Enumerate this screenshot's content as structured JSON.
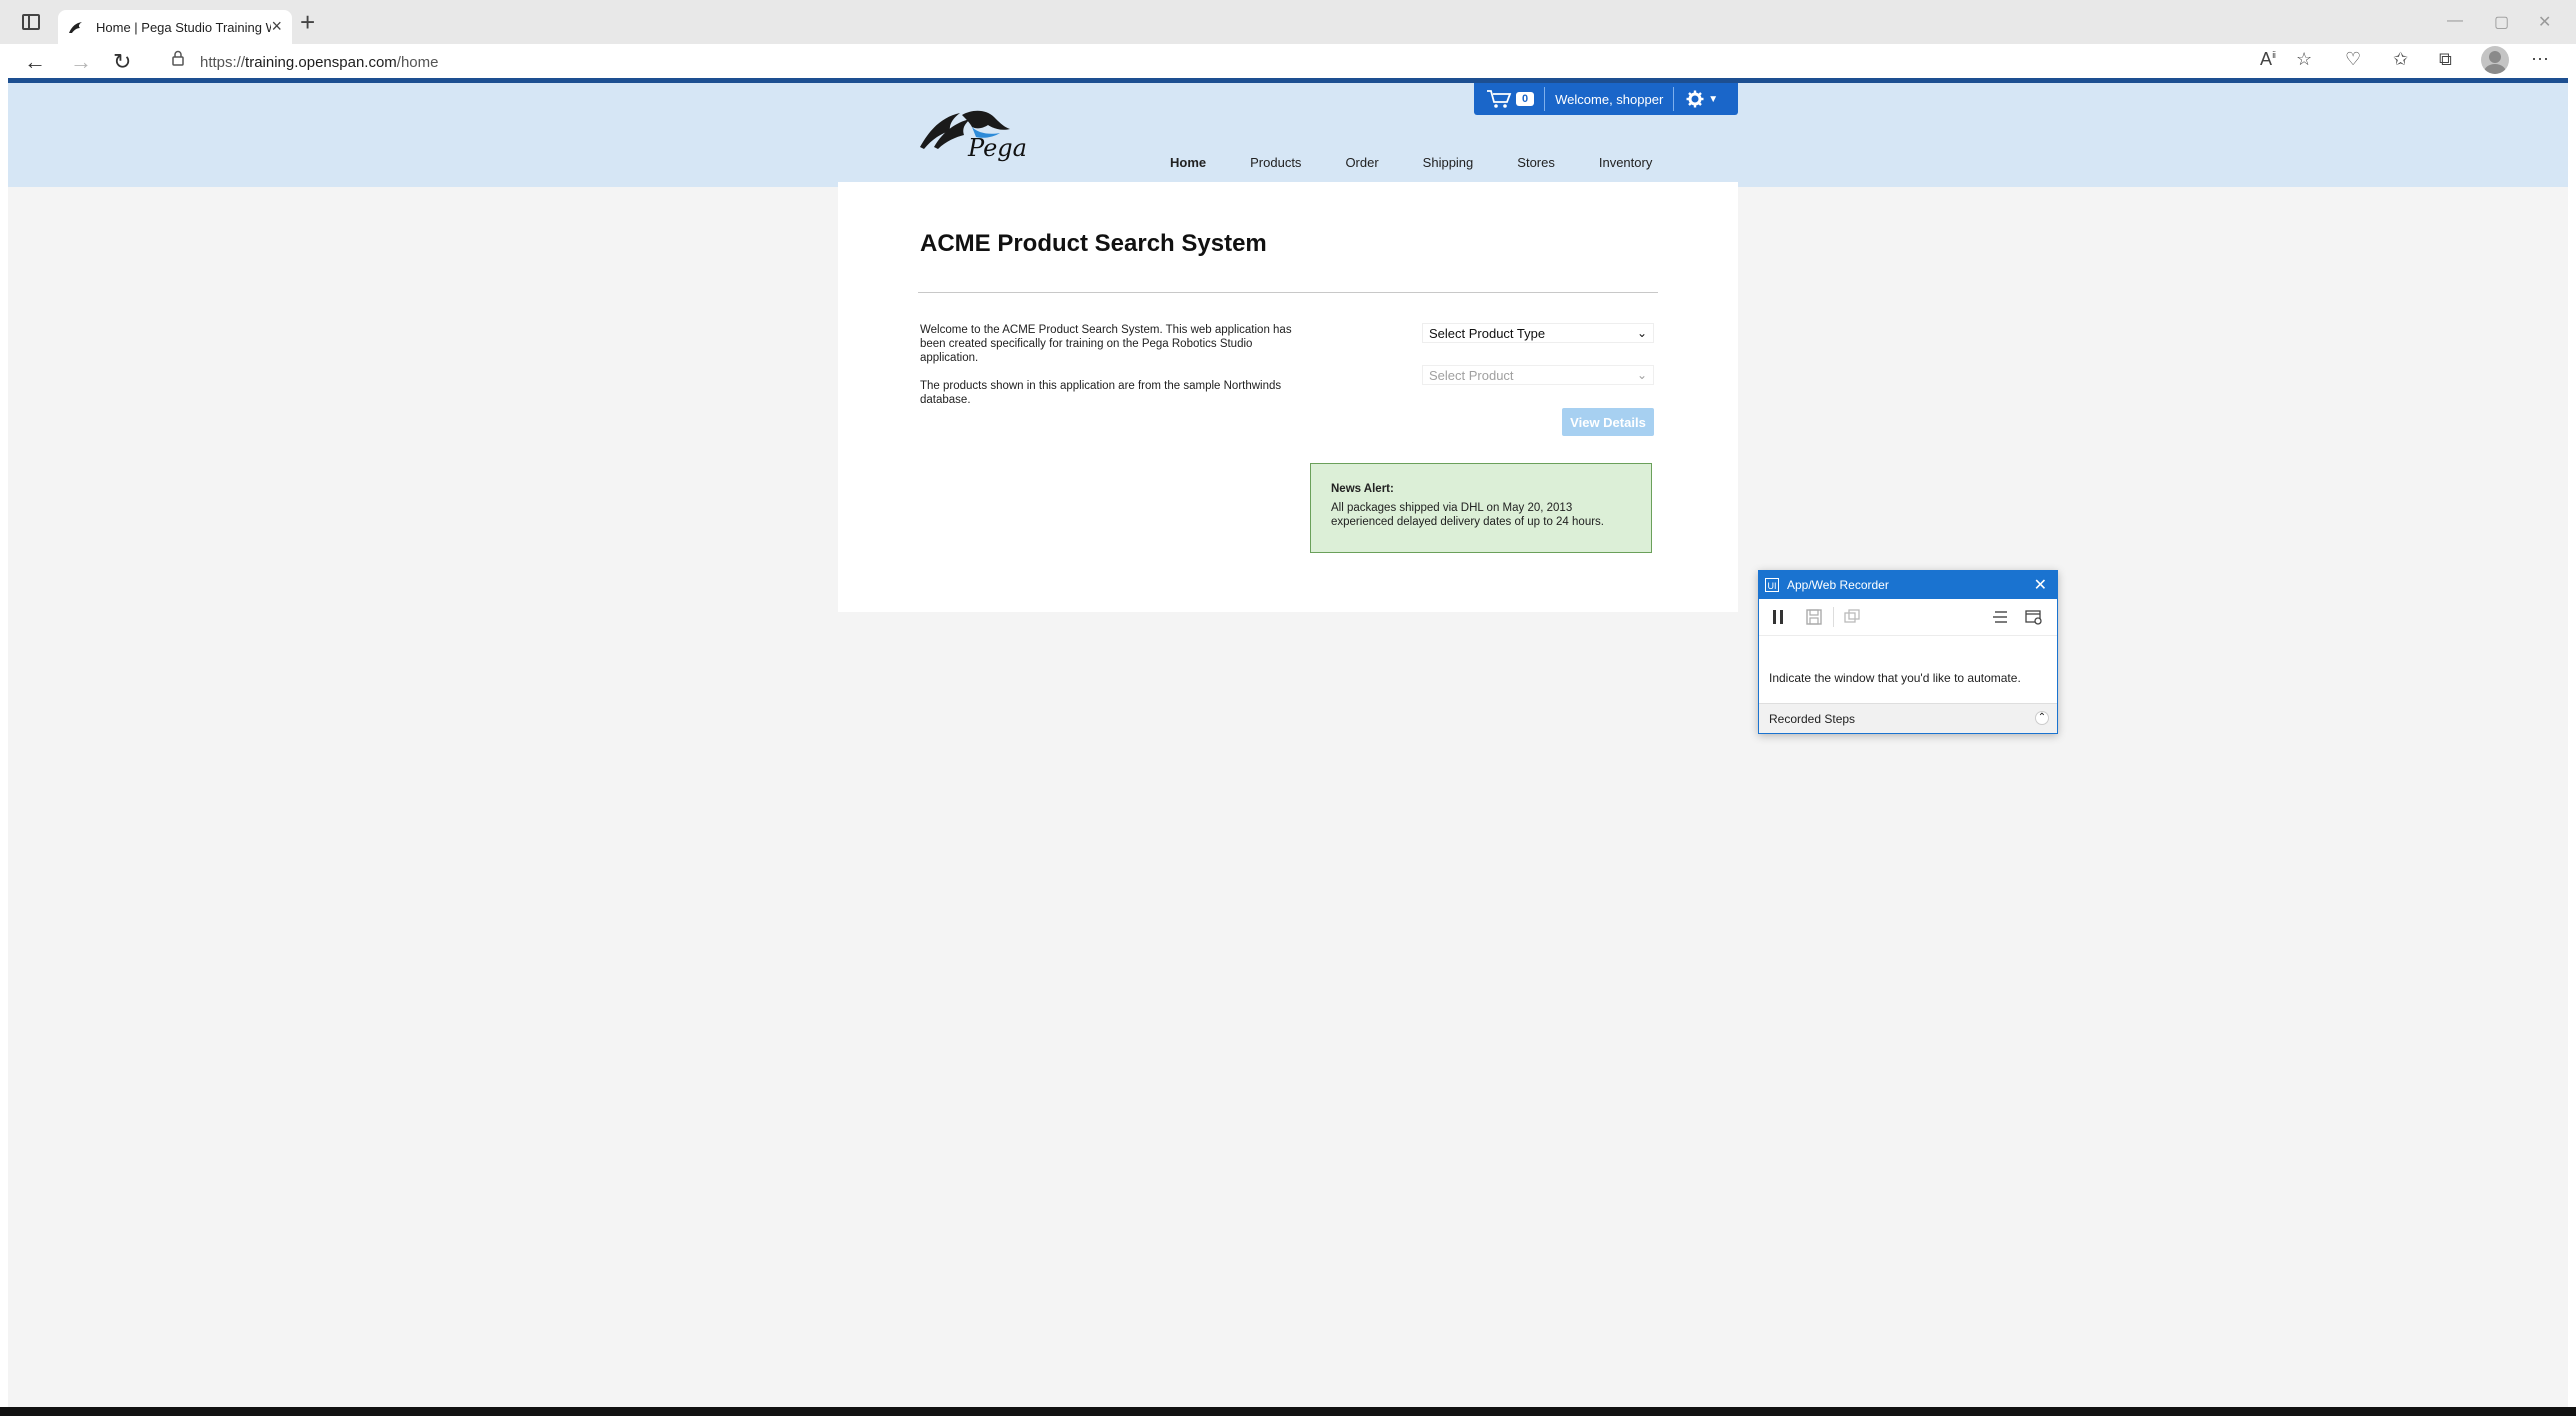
{
  "browser": {
    "tab_title": "Home | Pega Studio Training We",
    "url_scheme": "https://",
    "url_host": "training.openspan.com",
    "url_path": "/home"
  },
  "site": {
    "logo_text": "Pega",
    "cart_count": "0",
    "welcome": "Welcome, shopper",
    "nav": [
      "Home",
      "Products",
      "Order",
      "Shipping",
      "Stores",
      "Inventory"
    ],
    "active_nav": "Home"
  },
  "main": {
    "title": "ACME Product Search System",
    "intro_p1": "Welcome to the ACME Product Search System. This web application has been created specifically for training on the Pega Robotics Studio application.",
    "intro_p2": "The products shown in this application are from the sample Northwinds database.",
    "product_type_select": "Select Product Type",
    "product_select": "Select Product",
    "view_details": "View Details",
    "news_heading": "News Alert:",
    "news_body": "All packages shipped via DHL on May 20, 2013 experienced delayed delivery dates of up to 24 hours."
  },
  "recorder": {
    "title": "App/Web Recorder",
    "message": "Indicate the window that you'd like to automate.",
    "steps_label": "Recorded Steps"
  },
  "colors": {
    "header_bg": "#d6e6f5",
    "brand_blue": "#1a66c9",
    "news_bg": "#dcefd7",
    "view_btn": "#a7d0f1"
  }
}
